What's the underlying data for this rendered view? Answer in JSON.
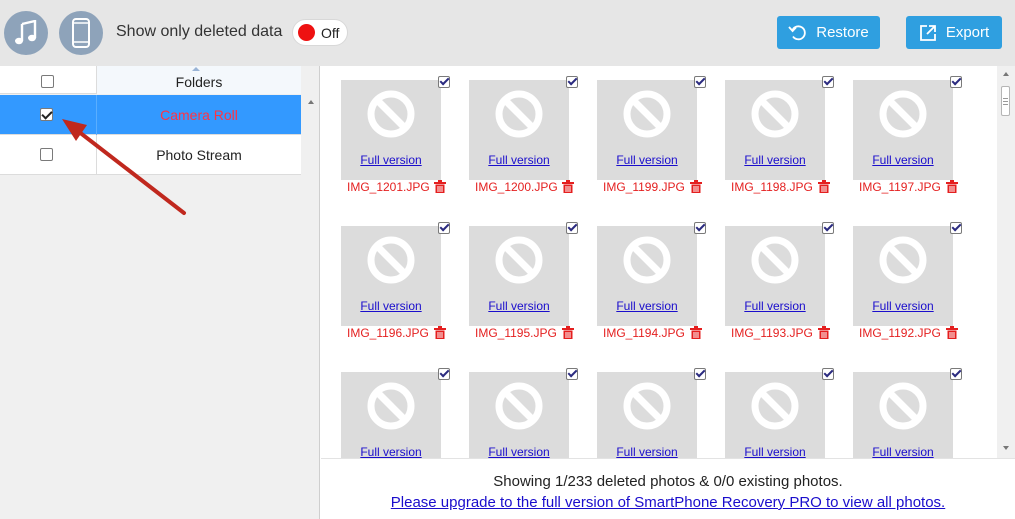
{
  "toolbar": {
    "deleted_only_label": "Show only deleted data",
    "toggle_state": "Off",
    "restore_label": "Restore",
    "export_label": "Export",
    "accent_color": "#2f9fe0",
    "toggle_knob_color": "#ee1111"
  },
  "folders": {
    "header": "Folders",
    "items": [
      {
        "name": "Camera Roll",
        "checked": true,
        "selected": true
      },
      {
        "name": "Photo Stream",
        "checked": false,
        "selected": false
      }
    ]
  },
  "photos": {
    "full_version_label": "Full version",
    "files": [
      "IMG_1201.JPG",
      "IMG_1200.JPG",
      "IMG_1199.JPG",
      "IMG_1198.JPG",
      "IMG_1197.JPG",
      "IMG_1196.JPG",
      "IMG_1195.JPG",
      "IMG_1194.JPG",
      "IMG_1193.JPG",
      "IMG_1192.JPG",
      "",
      "",
      "",
      "",
      ""
    ],
    "deleted_color": "#e41f1f"
  },
  "status": {
    "summary": "Showing 1/233 deleted photos & 0/0 existing photos.",
    "upgrade_text": "Please upgrade to the full version of SmartPhone Recovery PRO to view all photos."
  }
}
